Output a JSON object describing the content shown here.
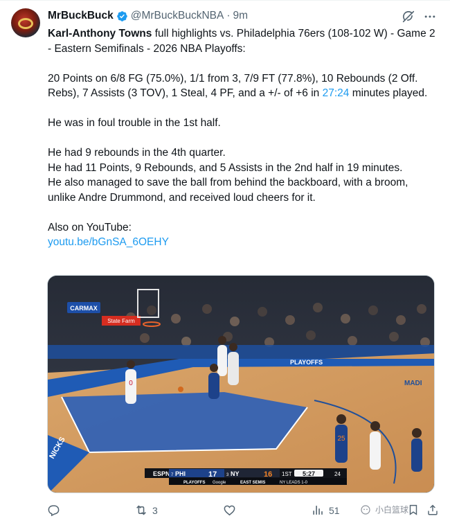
{
  "author": {
    "display_name": "MrBuckBuck",
    "handle": "@MrBuckBuckNBA",
    "separator": "·",
    "time": "9m"
  },
  "tweet": {
    "line1_name": "Karl-Anthony Towns",
    "line1_rest": " full highlights vs. Philadelphia 76ers (108-102 W) - Game 2 - Eastern Semifinals - 2026 NBA Playoffs:",
    "stats_before": "20 Points on 6/8 FG (75.0%), 1/1 from 3, 7/9 FT (77.8%), 10 Rebounds (2 Off. Rebs), 7 Assists (3 TOV), 1 Steal, 4 PF, and a +/- of +6 in ",
    "stats_minutes": "27:24",
    "stats_after": " minutes played.",
    "foul_line": "He was in foul trouble in the 1st half.",
    "rebounds_line": "He had 9 rebounds in the 4th quarter.",
    "half_line": "He had 11 Points, 9 Rebounds, and 5 Assists in the 2nd half in 19 minutes.",
    "broom_line": "He also managed to save the ball from behind the backboard, with a broom, unlike Andre Drummond, and received loud cheers for it.",
    "youtube_label": "Also on YouTube:",
    "youtube_link": "youtu.be/bGnSA_6OEHY"
  },
  "media": {
    "court_signage": [
      "CARMAX",
      "State Farm",
      "PLAYOFFS",
      "MADI",
      "NICKS"
    ],
    "scoreboard": {
      "network": "ESPN",
      "away_seed": "7",
      "away_team": "PHI",
      "away_score": "17",
      "home_seed": "3",
      "home_team": "NY",
      "home_score": "16",
      "period": "1ST",
      "clock": "5:27",
      "shot_clock": "24",
      "series_label": "PLAYOFFS",
      "sponsor": "Google",
      "round_label": "EAST SEMIS",
      "series_status": "NY LEADS 1-0"
    },
    "jerseys": [
      "0",
      "25"
    ],
    "watermark": "小白篮球"
  },
  "actions": {
    "reply_count": "",
    "retweet_count": "3",
    "like_count": "",
    "views_count": "51"
  }
}
